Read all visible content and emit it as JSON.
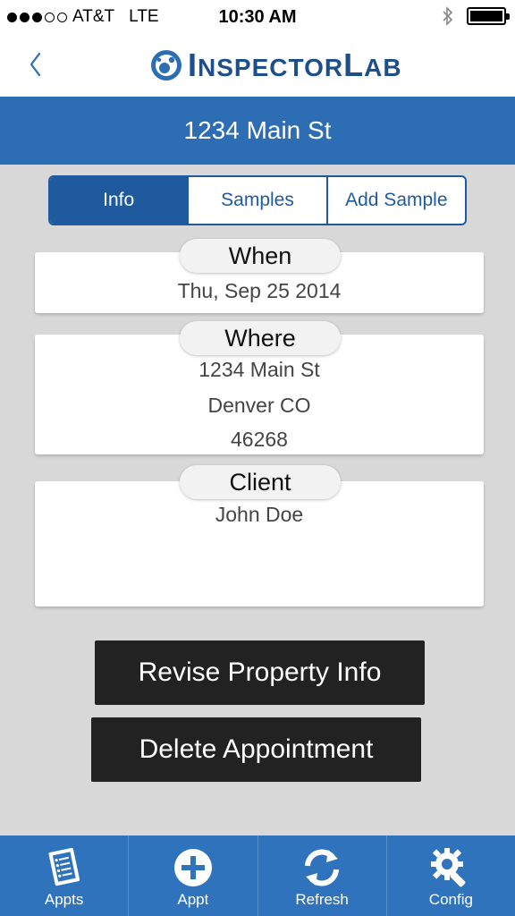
{
  "status_bar": {
    "carrier": "AT&T",
    "network": "LTE",
    "time": "10:30 AM"
  },
  "header": {
    "logo_text_big1": "I",
    "logo_text_small1": "NSPECTOR",
    "logo_text_big2": "L",
    "logo_text_small2": "AB",
    "back_icon": "chevron-left-icon"
  },
  "title_bar": {
    "address": "1234 Main St"
  },
  "segments": [
    {
      "label": "Info",
      "active": true
    },
    {
      "label": "Samples",
      "active": false
    },
    {
      "label": "Add Sample",
      "active": false
    }
  ],
  "cards": {
    "when": {
      "label": "When",
      "value": "Thu, Sep 25 2014"
    },
    "where": {
      "label": "Where",
      "line1": "1234 Main St",
      "line2": "Denver CO",
      "line3": "46268"
    },
    "client": {
      "label": "Client",
      "value": "John Doe"
    }
  },
  "actions": {
    "revise_label": "Revise Property Info",
    "delete_label": "Delete Appointment"
  },
  "tab_bar": [
    {
      "label": "Appts",
      "icon": "clipboard-list-icon"
    },
    {
      "label": "Appt",
      "icon": "plus-circle-icon"
    },
    {
      "label": "Refresh",
      "icon": "refresh-icon"
    },
    {
      "label": "Config",
      "icon": "gear-wrench-icon"
    }
  ],
  "colors": {
    "brand_blue": "#2d6db3",
    "segment_blue": "#1f5a9e",
    "button_black": "#222222",
    "background": "#d8d8d8"
  }
}
